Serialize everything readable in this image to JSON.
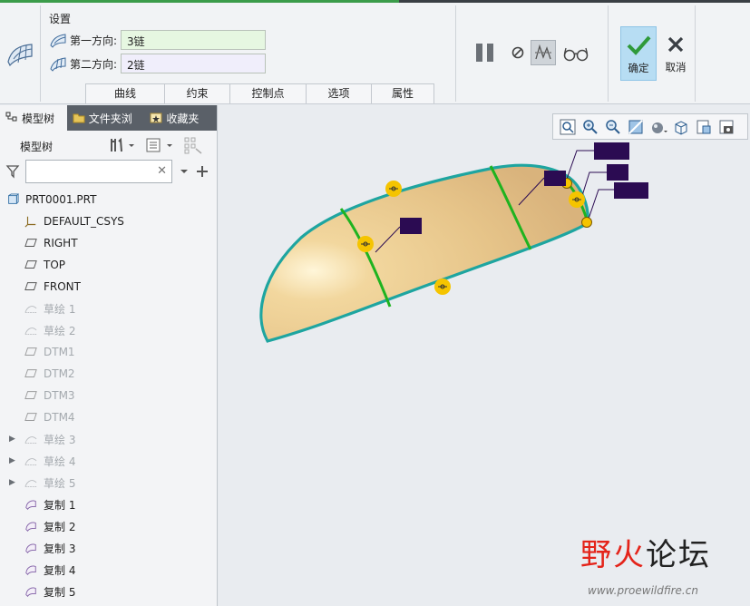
{
  "ribbon": {
    "settings_title": "设置",
    "first_direction": {
      "label": "第一方向:",
      "value": "3链"
    },
    "second_direction": {
      "label": "第二方向:",
      "value": "2链"
    },
    "tabs": [
      "曲线",
      "约束",
      "控制点",
      "选项",
      "属性"
    ],
    "ok_label": "确定",
    "cancel_label": "取消"
  },
  "left_panel": {
    "tabs": [
      "模型树",
      "文件夹浏",
      "收藏夹"
    ],
    "tree_title": "模型树",
    "filter_placeholder": "",
    "items": [
      {
        "label": "PRT0001.PRT",
        "icon": "part-icon",
        "dim": false,
        "expander": false,
        "indent": 0
      },
      {
        "label": "DEFAULT_CSYS",
        "icon": "csys-icon",
        "dim": false,
        "expander": false,
        "indent": 1
      },
      {
        "label": "RIGHT",
        "icon": "datum-plane-icon",
        "dim": false,
        "expander": false,
        "indent": 1
      },
      {
        "label": "TOP",
        "icon": "datum-plane-icon",
        "dim": false,
        "expander": false,
        "indent": 1
      },
      {
        "label": "FRONT",
        "icon": "datum-plane-icon",
        "dim": false,
        "expander": false,
        "indent": 1
      },
      {
        "label": "草绘 1",
        "icon": "sketch-icon",
        "dim": true,
        "expander": false,
        "indent": 1
      },
      {
        "label": "草绘 2",
        "icon": "sketch-icon",
        "dim": true,
        "expander": false,
        "indent": 1
      },
      {
        "label": "DTM1",
        "icon": "datum-plane-icon",
        "dim": true,
        "expander": false,
        "indent": 1
      },
      {
        "label": "DTM2",
        "icon": "datum-plane-icon",
        "dim": true,
        "expander": false,
        "indent": 1
      },
      {
        "label": "DTM3",
        "icon": "datum-plane-icon",
        "dim": true,
        "expander": false,
        "indent": 1
      },
      {
        "label": "DTM4",
        "icon": "datum-plane-icon",
        "dim": true,
        "expander": false,
        "indent": 1
      },
      {
        "label": "草绘 3",
        "icon": "sketch-icon",
        "dim": true,
        "expander": true,
        "indent": 1
      },
      {
        "label": "草绘 4",
        "icon": "sketch-icon",
        "dim": true,
        "expander": true,
        "indent": 1
      },
      {
        "label": "草绘 5",
        "icon": "sketch-icon",
        "dim": true,
        "expander": true,
        "indent": 1
      },
      {
        "label": "复制 1",
        "icon": "copy-surface-icon",
        "dim": false,
        "expander": false,
        "indent": 1
      },
      {
        "label": "复制 2",
        "icon": "copy-surface-icon",
        "dim": false,
        "expander": false,
        "indent": 1
      },
      {
        "label": "复制 3",
        "icon": "copy-surface-icon",
        "dim": false,
        "expander": false,
        "indent": 1
      },
      {
        "label": "复制 4",
        "icon": "copy-surface-icon",
        "dim": false,
        "expander": false,
        "indent": 1
      },
      {
        "label": "复制 5",
        "icon": "copy-surface-icon",
        "dim": false,
        "expander": false,
        "indent": 1
      }
    ]
  },
  "watermark": {
    "title_red": "野火",
    "title_dark": "论坛",
    "url": "www.proewildfire.cn"
  },
  "colors": {
    "surface": "#e9c990",
    "boundary": "#1ea5a0",
    "curve": "#1fb31f",
    "handle": "#f5c400",
    "callout": "#2b0b52",
    "ok_bg": "#b7ddf3"
  }
}
